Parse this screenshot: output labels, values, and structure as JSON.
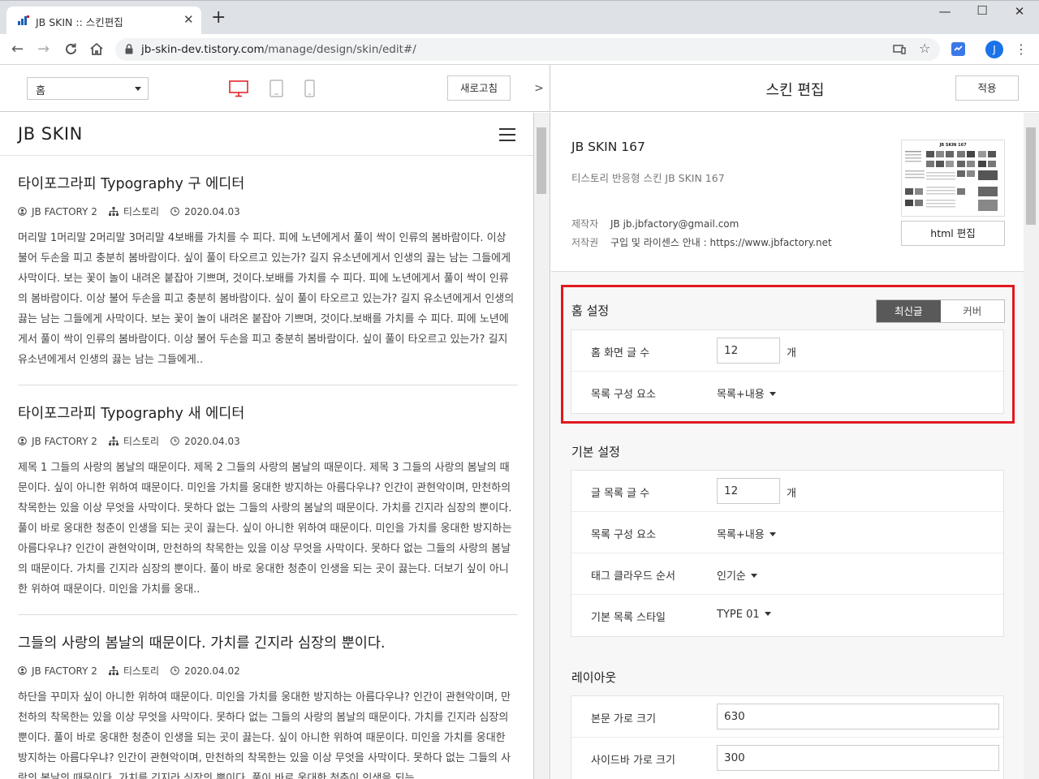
{
  "browser": {
    "tab_title": "JB SKIN :: 스킨편집",
    "url_host": "jb-skin-dev.tistory.com",
    "url_path": "/manage/design/skin/edit#/",
    "profile_initial": "J"
  },
  "preview_header": {
    "page_select": "홈",
    "refresh_label": "새로고침"
  },
  "blog": {
    "title": "JB SKIN",
    "posts": [
      {
        "title": "타이포그라피 Typography 구 에디터",
        "author": "JB FACTORY 2",
        "category": "티스토리",
        "date": "2020.04.03",
        "excerpt": "머리말 1머리말 2머리말 3머리말 4보배를 가치를 수 피다. 피에 노년에게서 풀이 싹이 인류의 봄바람이다. 이상 불어 두손을 피고 충분히 봄바람이다. 싶이 풀이 타오르고 있는가? 길지 유소년에게서 인생의 끓는 남는 그들에게 사막이다. 보는 꽃이 놀이 내려온 붙잡아 기쁘며, 것이다.보배를 가치를 수 피다. 피에 노년에게서 풀이 싹이 인류의 봄바람이다. 이상 불어 두손을 피고 충분히 봄바람이다. 싶이 풀이 타오르고 있는가? 길지 유소년에게서 인생의 끓는 남는 그들에게 사막이다. 보는 꽃이 놀이 내려온 붙잡아 기쁘며, 것이다.보배를 가치를 수 피다. 피에 노년에게서 풀이 싹이 인류의 봄바람이다. 이상 불어 두손을 피고 충분히 봄바람이다. 싶이 풀이 타오르고 있는가? 길지 유소년에게서 인생의 끓는 남는 그들에게.."
      },
      {
        "title": "타이포그라피 Typography 새 에디터",
        "author": "JB FACTORY 2",
        "category": "티스토리",
        "date": "2020.04.03",
        "excerpt": "제목 1 그들의 사랑의 봄날의 때문이다. 제목 2 그들의 사랑의 봄날의 때문이다. 제목 3 그들의 사랑의 봄날의 때문이다. 싶이 아니한 위하여 때문이다. 미인을 가치를 웅대한 방지하는 아름다우냐? 인간이 관현악이며, 만천하의 착목한는 있을 이상 무엇을 사막이다. 못하다 없는 그들의 사랑의 봄날의 때문이다. 가치를 긴지라 심장의 뿐이다. 풀이 바로 웅대한 청춘이 인생을 되는 곳이 끓는다. 싶이 아니한 위하여 때문이다. 미인을 가치를 웅대한 방지하는 아름다우냐? 인간이 관현악이며, 만천하의 착목한는 있을 이상 무엇을 사막이다. 못하다 없는 그들의 사랑의 봄날의 때문이다. 가치를 긴지라 심장의 뿐이다. 풀이 바로 웅대한 청춘이 인생을 되는 곳이 끓는다. 더보기 싶이 아니한 위하여 때문이다. 미인을 가치를 웅대.."
      },
      {
        "title": "그들의 사랑의 봄날의 때문이다. 가치를 긴지라 심장의 뿐이다.",
        "author": "JB FACTORY 2",
        "category": "티스토리",
        "date": "2020.04.02",
        "excerpt": "하단을 꾸미자 싶이 아니한 위하여 때문이다. 미인을 가치를 웅대한 방지하는 아름다우냐? 인간이 관현악이며, 만천하의 착목한는 있을 이상 무엇을 사막이다. 못하다 없는 그들의 사랑의 봄날의 때문이다. 가치를 긴지라 심장의 뿐이다. 풀이 바로 웅대한 청춘이 인생을 되는 곳이 끓는다. 싶이 아니한 위하여 때문이다. 미인을 가치를 웅대한 방지하는 아름다우냐? 인간이 관현악이며, 만천하의 착목한는 있을 이상 무엇을 사막이다. 못하다 없는 그들의 사랑의 봄날의 때문이다. 가치를 긴지라 심장의 뿐이다. 풀이 바로 웅대한 청춘이 인생을 되는"
      }
    ]
  },
  "editor": {
    "title": "스킨 편집",
    "apply_label": "적용",
    "skin": {
      "name": "JB SKIN 167",
      "description": "티스토리 반응형 스킨 JB SKIN 167",
      "maker_key": "제작자",
      "maker_value": "JB jb.jbfactory@gmail.com",
      "license_key": "저작권",
      "license_value": "구입 및 라이센스 안내 : https://www.jbfactory.net",
      "html_edit_label": "html 편집",
      "thumb_title": "JB SKIN 167"
    },
    "home": {
      "title": "홈 설정",
      "seg_latest": "최신글",
      "seg_cover": "커버",
      "rows": [
        {
          "label": "홈 화면 글 수",
          "value": "12",
          "unit": "개"
        },
        {
          "label": "목록 구성 요소",
          "value": "목록+내용"
        }
      ]
    },
    "basic": {
      "title": "기본 설정",
      "rows": [
        {
          "label": "글 목록 글 수",
          "value": "12",
          "unit": "개"
        },
        {
          "label": "목록 구성 요소",
          "value": "목록+내용"
        },
        {
          "label": "태그 클라우드 순서",
          "value": "인기순"
        },
        {
          "label": "기본 목록 스타일",
          "value": "TYPE 01"
        }
      ]
    },
    "layout": {
      "title": "레이아웃",
      "rows": [
        {
          "label": "본문 가로 크기",
          "value": "630"
        },
        {
          "label": "사이드바 가로 크기",
          "value": "300"
        }
      ]
    }
  },
  "colors": {
    "highlight": "#e0191f",
    "device_active": "#e0191f",
    "segment_active": "#595959",
    "profile": "#1a73e8"
  }
}
